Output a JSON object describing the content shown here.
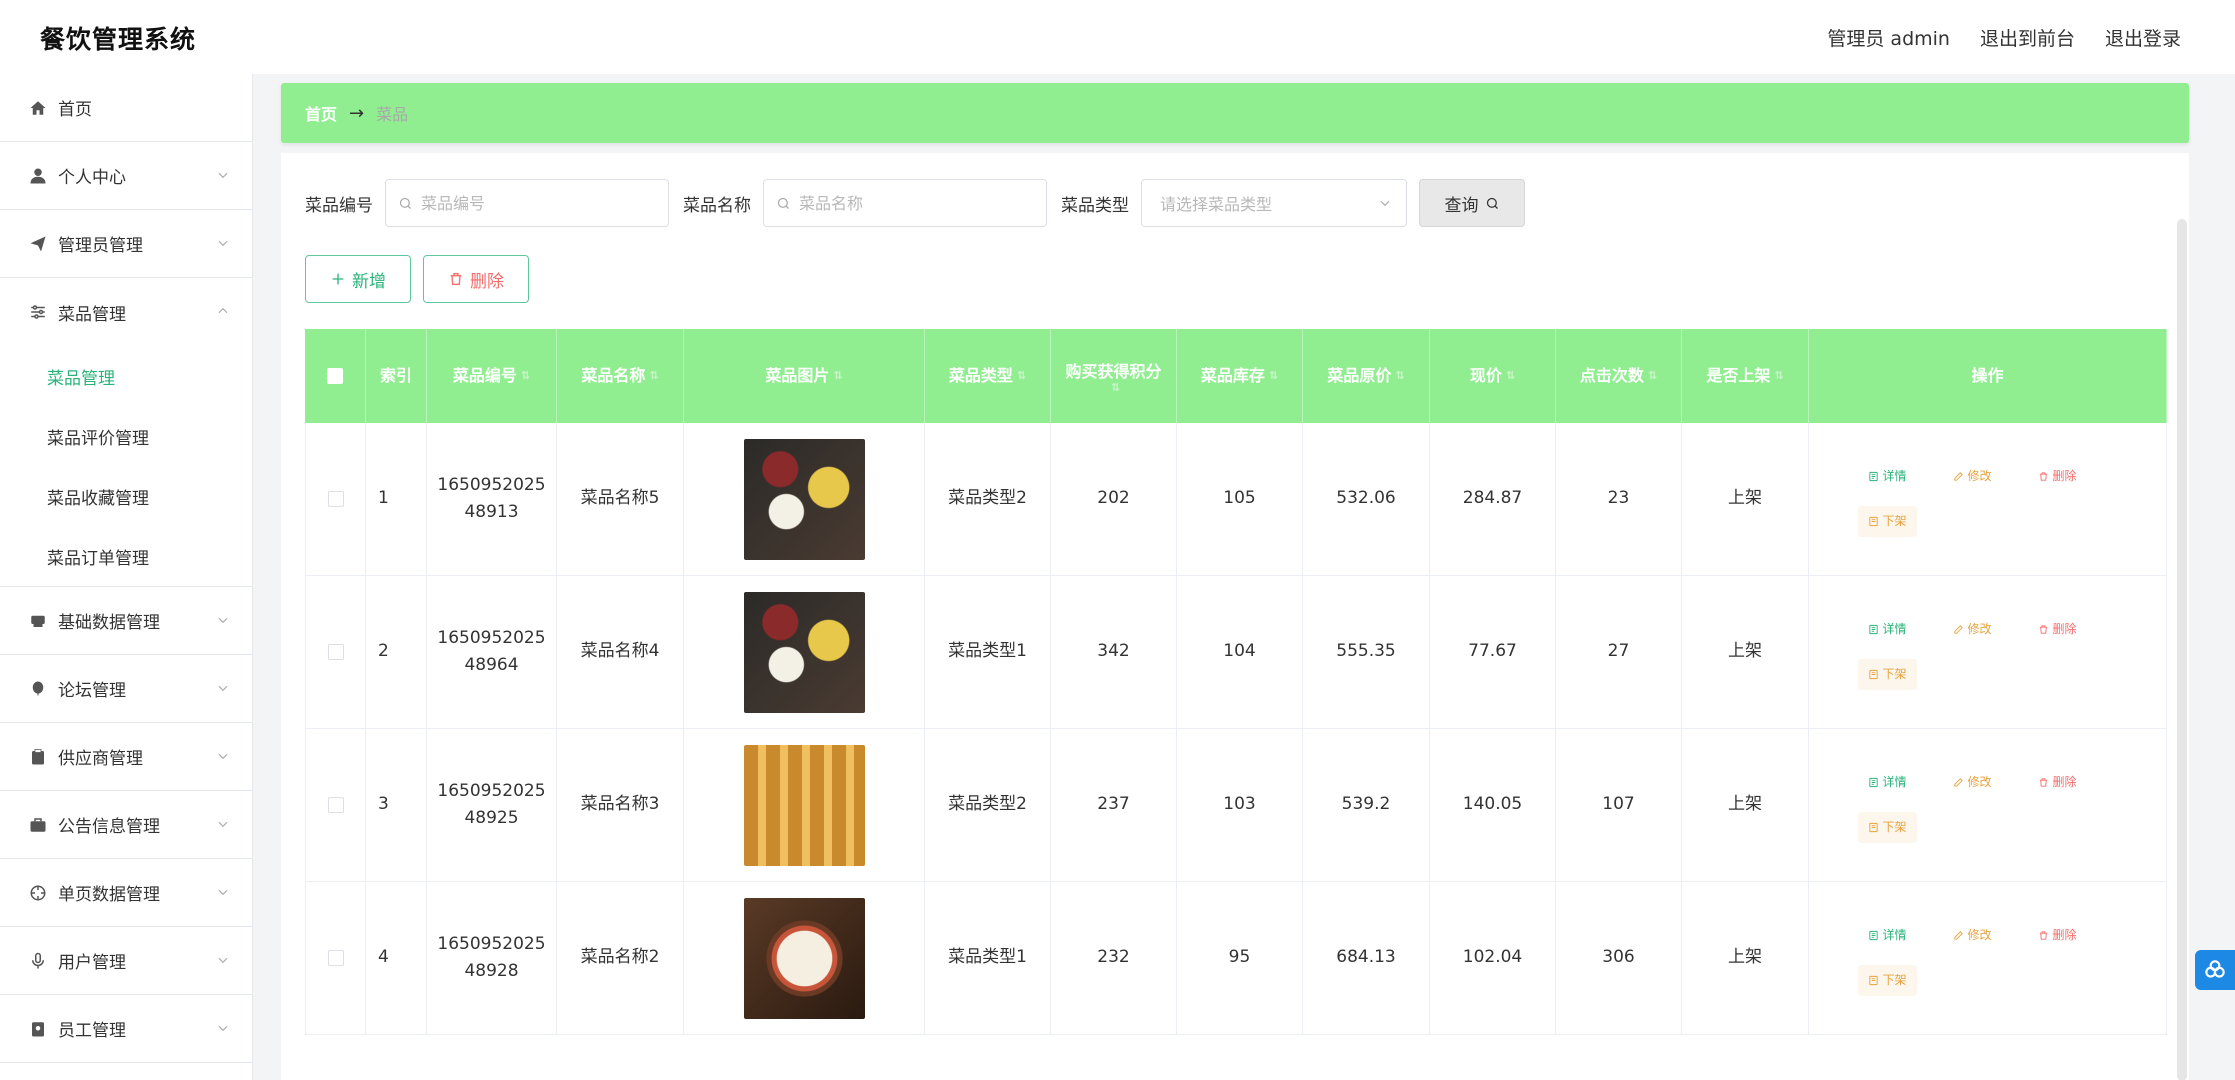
{
  "app": {
    "title": "餐饮管理系统"
  },
  "header": {
    "user": "管理员 admin",
    "to_front": "退出到前台",
    "logout": "退出登录"
  },
  "sidebar": {
    "home": "首页",
    "personal": "个人中心",
    "admin_mgmt": "管理员管理",
    "dish_mgmt": "菜品管理",
    "dish_sub": [
      "菜品管理",
      "菜品评价管理",
      "菜品收藏管理",
      "菜品订单管理"
    ],
    "base_data": "基础数据管理",
    "forum": "论坛管理",
    "supplier": "供应商管理",
    "notice": "公告信息管理",
    "single_page": "单页数据管理",
    "user_mgmt": "用户管理",
    "staff_mgmt": "员工管理"
  },
  "breadcrumb": {
    "home": "首页",
    "arrow": "→",
    "current": "菜品"
  },
  "search": {
    "code_label": "菜品编号",
    "code_placeholder": "菜品编号",
    "name_label": "菜品名称",
    "name_placeholder": "菜品名称",
    "type_label": "菜品类型",
    "type_placeholder": "请选择菜品类型",
    "query": "查询"
  },
  "actions": {
    "add": "新增",
    "delete": "删除"
  },
  "table": {
    "headers": {
      "index": "索引",
      "code": "菜品编号",
      "name": "菜品名称",
      "image": "菜品图片",
      "type": "菜品类型",
      "points": "购买获得积分",
      "stock": "菜品库存",
      "orig_price": "菜品原价",
      "cur_price": "现价",
      "clicks": "点击次数",
      "on_shelf": "是否上架",
      "ops": "操作"
    },
    "op_labels": {
      "detail": "详情",
      "edit": "修改",
      "delete": "删除",
      "off": "下架"
    },
    "rows": [
      {
        "index": "1",
        "code": "165095202548913",
        "name": "菜品名称5",
        "type": "菜品类型2",
        "points": "202",
        "stock": "105",
        "orig_price": "532.06",
        "cur_price": "284.87",
        "clicks": "23",
        "on_shelf": "上架"
      },
      {
        "index": "2",
        "code": "165095202548964",
        "name": "菜品名称4",
        "type": "菜品类型1",
        "points": "342",
        "stock": "104",
        "orig_price": "555.35",
        "cur_price": "77.67",
        "clicks": "27",
        "on_shelf": "上架"
      },
      {
        "index": "3",
        "code": "165095202548925",
        "name": "菜品名称3",
        "type": "菜品类型2",
        "points": "237",
        "stock": "103",
        "orig_price": "539.2",
        "cur_price": "140.05",
        "clicks": "107",
        "on_shelf": "上架"
      },
      {
        "index": "4",
        "code": "165095202548928",
        "name": "菜品名称2",
        "type": "菜品类型1",
        "points": "232",
        "stock": "95",
        "orig_price": "684.13",
        "cur_price": "102.04",
        "clicks": "306",
        "on_shelf": "上架"
      }
    ]
  },
  "colors": {
    "accent": "#90ee90",
    "primary_text": "#29b37a",
    "danger": "#f56c6c",
    "warning": "#e6a23c"
  }
}
